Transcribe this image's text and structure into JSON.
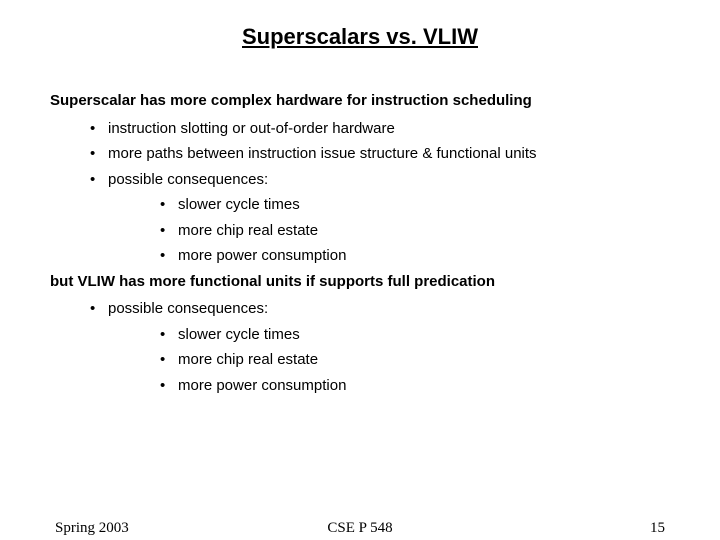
{
  "title": "Superscalars vs. VLIW",
  "section1_lead": "Superscalar has more complex hardware for instruction scheduling",
  "s1": {
    "b1": "instruction slotting or out-of-order hardware",
    "b2": "more paths between instruction issue structure & functional units",
    "b3": "possible consequences:",
    "sub": {
      "c1": "slower cycle times",
      "c2": "more chip real estate",
      "c3": "more power consumption"
    }
  },
  "section2_lead": "but VLIW has more functional units if supports full predication",
  "s2": {
    "b1": "possible consequences:",
    "sub": {
      "c1": "slower cycle times",
      "c2": "more chip real estate",
      "c3": "more power consumption"
    }
  },
  "footer": {
    "term": "Spring 2003",
    "course": "CSE P 548",
    "page": "15"
  }
}
